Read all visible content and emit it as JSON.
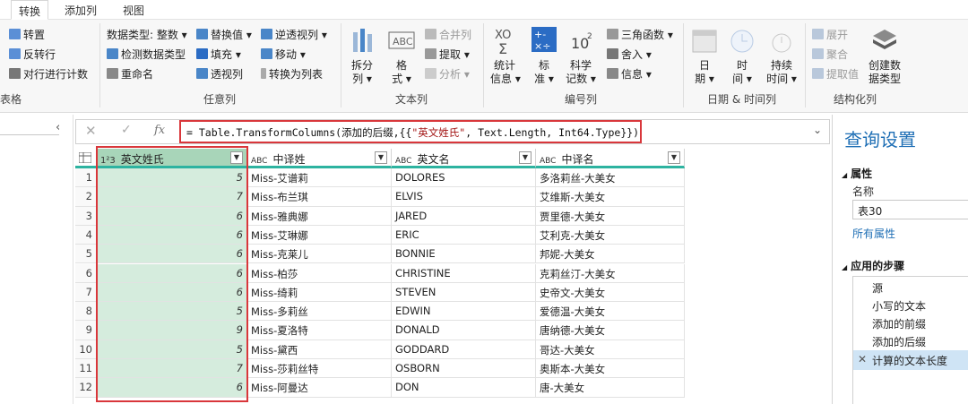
{
  "tabs": [
    "转换",
    "添加列",
    "视图"
  ],
  "ribbon": {
    "g1": {
      "items": [
        "转置",
        "反转行",
        "对行进行计数"
      ],
      "label": "表格"
    },
    "g2": {
      "col1": [
        "数据类型: 整数 ▾",
        "检测数据类型",
        "重命名"
      ],
      "col2": [
        "替换值 ▾",
        "填充 ▾",
        "透视列"
      ],
      "col3": [
        "逆透视列 ▾",
        "移动 ▾",
        "转换为列表"
      ],
      "label": "任意列"
    },
    "g3": {
      "split": "拆分\n列 ▾",
      "format": "格\n式 ▾",
      "merge": "合并列",
      "extract": "提取 ▾",
      "parse": "分析 ▾",
      "label": "文本列"
    },
    "g4": {
      "stats": "统计\n信息 ▾",
      "standard": "标\n准 ▾",
      "sci": "科学\n记数 ▾",
      "trig": "三角函数 ▾",
      "round": "舍入 ▾",
      "info": "信息 ▾",
      "label": "编号列"
    },
    "g5": {
      "date": "日\n期 ▾",
      "time": "时\n间 ▾",
      "duration": "持续\n时间 ▾",
      "label": "日期 & 时间列"
    },
    "g6": {
      "expand": "展开",
      "aggregate": "聚合",
      "extract_values": "提取值",
      "create": "创建数\n据类型",
      "label": "结构化列"
    }
  },
  "formula": {
    "prefix": "= Table.TransformColumns(添加的后缀,{{",
    "str": "\"英文姓氏\"",
    "suffix": ", Text.Length, Int64.Type}})",
    "fx": "fx"
  },
  "columns": [
    {
      "type": "1²3",
      "name": "英文姓氏"
    },
    {
      "type": "ABC",
      "name": "中译姓"
    },
    {
      "type": "ABC",
      "name": "英文名"
    },
    {
      "type": "ABC",
      "name": "中译名"
    }
  ],
  "rows": [
    [
      "1",
      "5",
      "Miss-艾谱莉",
      "DOLORES",
      "多洛莉丝-大美女"
    ],
    [
      "2",
      "7",
      "Miss-布兰琪",
      "ELVIS",
      "艾维斯-大美女"
    ],
    [
      "3",
      "6",
      "Miss-雅典娜",
      "JARED",
      "贾里德-大美女"
    ],
    [
      "4",
      "6",
      "Miss-艾琳娜",
      "ERIC",
      "艾利克-大美女"
    ],
    [
      "5",
      "6",
      "Miss-克莱儿",
      "BONNIE",
      "邦妮-大美女"
    ],
    [
      "6",
      "6",
      "Miss-柏莎",
      "CHRISTINE",
      "克莉丝汀-大美女"
    ],
    [
      "7",
      "6",
      "Miss-绮莉",
      "STEVEN",
      "史帝文-大美女"
    ],
    [
      "8",
      "5",
      "Miss-多莉丝",
      "EDWIN",
      "爱德温-大美女"
    ],
    [
      "9",
      "9",
      "Miss-夏洛特",
      "DONALD",
      "唐纳德-大美女"
    ],
    [
      "10",
      "5",
      "Miss-黛西",
      "GODDARD",
      "哥达-大美女"
    ],
    [
      "11",
      "7",
      "Miss-莎莉丝特",
      "OSBORN",
      "奥斯本-大美女"
    ],
    [
      "12",
      "6",
      "Miss-阿曼达",
      "DON",
      "唐-大美女"
    ]
  ],
  "pane": {
    "title": "查询设置",
    "props_heading": "属性",
    "name_label": "名称",
    "name_value": "表30",
    "all_props": "所有属性",
    "steps_heading": "应用的步骤",
    "steps": [
      "源",
      "小写的文本",
      "添加的前缀",
      "添加的后缀",
      "计算的文本长度"
    ]
  },
  "colors": {
    "accent": "#2db3a0",
    "highlight": "#d9373b",
    "selected_col": "#d5ecdd"
  }
}
